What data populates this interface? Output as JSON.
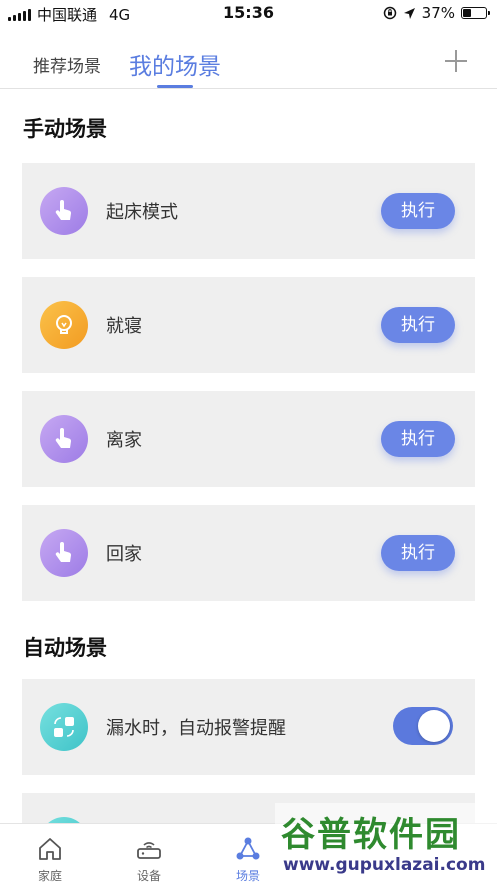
{
  "status_bar": {
    "carrier": "中国联通",
    "network": "4G",
    "time": "15:36",
    "battery": "37%",
    "battery_level": 0.37
  },
  "tabs": {
    "recommend": "推荐场景",
    "mine": "我的场景"
  },
  "manual": {
    "title": "手动场景",
    "execute_label": "执行",
    "items": [
      {
        "label": "起床模式",
        "icon": "hand-tap-icon"
      },
      {
        "label": "就寝",
        "icon": "lightbulb-icon"
      },
      {
        "label": "离家",
        "icon": "hand-tap-icon"
      },
      {
        "label": "回家",
        "icon": "hand-tap-icon"
      }
    ]
  },
  "auto": {
    "title": "自动场景",
    "items": [
      {
        "label": "漏水时，自动报警提醒",
        "icon": "automation-swap-icon",
        "enabled": true
      }
    ]
  },
  "bottom_nav": {
    "home": "家庭",
    "devices": "设备",
    "scenes": "场景"
  },
  "watermark": {
    "brand": "谷普软件园",
    "url": "www.gupuxlazai.com"
  },
  "colors": {
    "accent": "#5a7de0",
    "button": "#6a86e6",
    "card_bg": "#efefef"
  }
}
